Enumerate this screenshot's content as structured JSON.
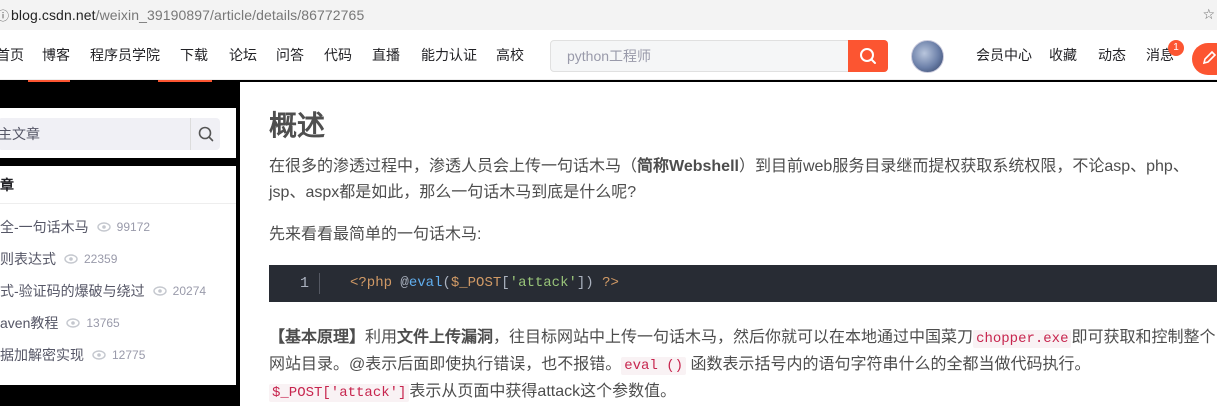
{
  "browser": {
    "url_host": "blog.csdn.net",
    "url_path": "/weixin_39190897/article/details/86772765"
  },
  "nav": {
    "items": [
      "首页",
      "博客",
      "程序员学院",
      "下载",
      "论坛",
      "问答",
      "代码",
      "直播",
      "能力认证",
      "高校"
    ],
    "search_placeholder": "python工程师",
    "right_items": [
      "会员中心",
      "收藏",
      "动态",
      "消息"
    ],
    "message_badge": "1"
  },
  "sidebar": {
    "search_text": "主文章",
    "list_header": "章",
    "items": [
      {
        "title": "全-一句话木马",
        "views": "99172"
      },
      {
        "title": "则表达式",
        "views": "22359"
      },
      {
        "title": "式-验证码的爆破与绕过",
        "views": "20274"
      },
      {
        "title": "aven教程",
        "views": "13765"
      },
      {
        "title": "据加解密实现",
        "views": "12775"
      }
    ]
  },
  "article": {
    "heading": "概述",
    "para1_a": "在很多的渗透过程中，渗透人员会上传一句话木马（",
    "para1_b": "简称Webshell",
    "para1_c": "）到目前web服务目录继而提权获取系统权限，不论asp、php、jsp、aspx都是如此，那么一句话木马到底是什么呢?",
    "para2": "先来看看最简单的一句话木马:",
    "code": {
      "line_no": "1",
      "php_open": "<?php",
      "at": "@",
      "fn": "eval",
      "open_paren": "(",
      "var": "$_POST",
      "bracket_open": "[",
      "str": "'attack'",
      "bracket_close": "])",
      "php_close": "?>"
    },
    "para3_a": "【基本原理】",
    "para3_b": "利用",
    "para3_c": "文件上传漏洞",
    "para3_d": "，往目标网站中上传一句话木马，然后你就可以在本地通过中国菜刀",
    "para3_code1": "chopper.exe",
    "para3_e": "即可获取和控制整个网站目录。@表示后面即使执行错误，也不报错。",
    "para3_code2": "eval ()",
    "para3_f": " 函数表示括号内的语句字符串什么的全都当做代码执行。",
    "para3_code3": "$_POST['attack']",
    "para3_g": "表示从页面中获得attack这个参数值。"
  },
  "colors": {
    "brand_red": "#fc5531",
    "code_bg": "#282c34",
    "inline_code": "#c7254e"
  }
}
